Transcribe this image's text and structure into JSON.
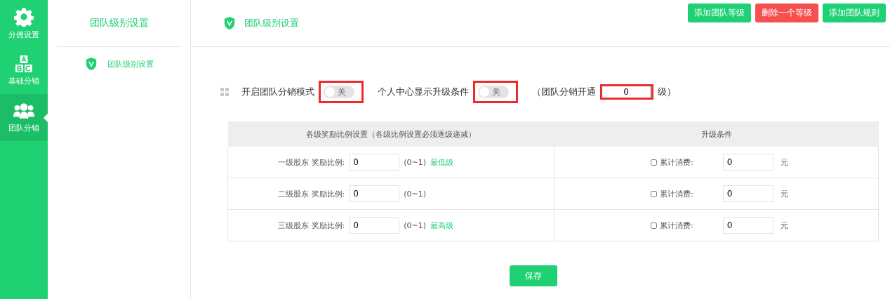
{
  "nav": [
    {
      "label": "分佣设置",
      "kind": "gear",
      "selected": false
    },
    {
      "label": "基础分销",
      "kind": "abc",
      "selected": false
    },
    {
      "label": "团队分销",
      "kind": "team",
      "selected": true
    }
  ],
  "subnav": {
    "title": "团队级别设置",
    "items": [
      {
        "label": "团队级别设置"
      }
    ]
  },
  "header": {
    "title": "团队级别设置",
    "buttons": [
      {
        "label": "添加团队等级",
        "kind": "primary"
      },
      {
        "label": "删除一个等级",
        "kind": "danger"
      },
      {
        "label": "添加团队规则",
        "kind": "primary"
      }
    ]
  },
  "settings": [
    {
      "kind": "toggle",
      "label": "开启团队分销模式",
      "on": false,
      "state_text": "关"
    },
    {
      "kind": "toggle",
      "label": "个人中心显示升级条件",
      "on": false,
      "state_text": "关"
    },
    {
      "kind": "number",
      "prefix": "（团队分销开通",
      "value": "0",
      "suffix": "级）"
    }
  ],
  "table": {
    "columns": [
      "各级奖励比例设置（各级比例设置必须逐级递减）",
      "升级条件"
    ],
    "rows": [
      {
        "level": "一级股东",
        "ratio_label": "奖励比例:",
        "ratio": "0",
        "range": "(0~1)",
        "note": "最低级",
        "condition": "累计消费:",
        "checked": false,
        "amount": "0",
        "unit": "元"
      },
      {
        "level": "二级股东",
        "ratio_label": "奖励比例:",
        "ratio": "0",
        "range": "(0~1)",
        "condition": "累计消费:",
        "checked": false,
        "amount": "0",
        "unit": "元"
      },
      {
        "level": "三级股东",
        "ratio_label": "奖励比例:",
        "ratio": "0",
        "range": "(0~1)",
        "note": "最高级",
        "condition": "累计消费:",
        "checked": false,
        "amount": "0",
        "unit": "元"
      }
    ]
  },
  "save_button": "保存"
}
